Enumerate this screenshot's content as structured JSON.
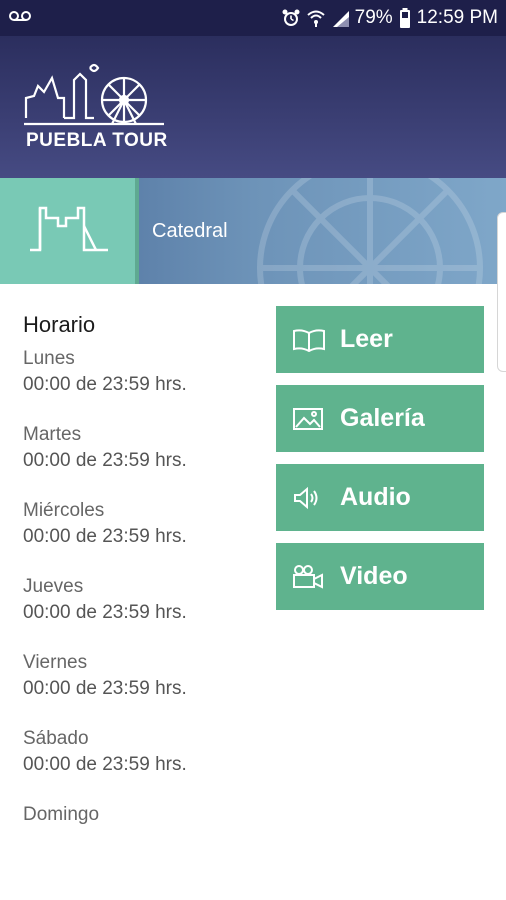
{
  "status_bar": {
    "battery": "79%",
    "time": "12:59 PM",
    "icons": [
      "voicemail-icon",
      "alarm-icon",
      "wifi-icon",
      "signal-icon",
      "battery-icon"
    ]
  },
  "header": {
    "logo_text": "PUEBLA TOUR"
  },
  "banner": {
    "title": "Catedral",
    "icon": "cathedral-icon"
  },
  "schedule": {
    "title": "Horario",
    "days": [
      {
        "name": "Lunes",
        "hours": "00:00 de 23:59 hrs."
      },
      {
        "name": "Martes",
        "hours": "00:00 de 23:59 hrs."
      },
      {
        "name": "Miércoles",
        "hours": "00:00 de 23:59 hrs."
      },
      {
        "name": "Jueves",
        "hours": "00:00 de 23:59 hrs."
      },
      {
        "name": "Viernes",
        "hours": "00:00 de 23:59 hrs."
      },
      {
        "name": "Sábado",
        "hours": "00:00 de 23:59 hrs."
      },
      {
        "name": "Domingo",
        "hours": ""
      }
    ]
  },
  "actions": [
    {
      "label": "Leer",
      "icon": "book-icon"
    },
    {
      "label": "Galería",
      "icon": "image-icon"
    },
    {
      "label": "Audio",
      "icon": "speaker-icon"
    },
    {
      "label": "Video",
      "icon": "video-camera-icon"
    }
  ],
  "colors": {
    "header_bg": "#2b2e5e",
    "accent_teal": "#79c9b5",
    "button_green": "#5fb38e"
  }
}
